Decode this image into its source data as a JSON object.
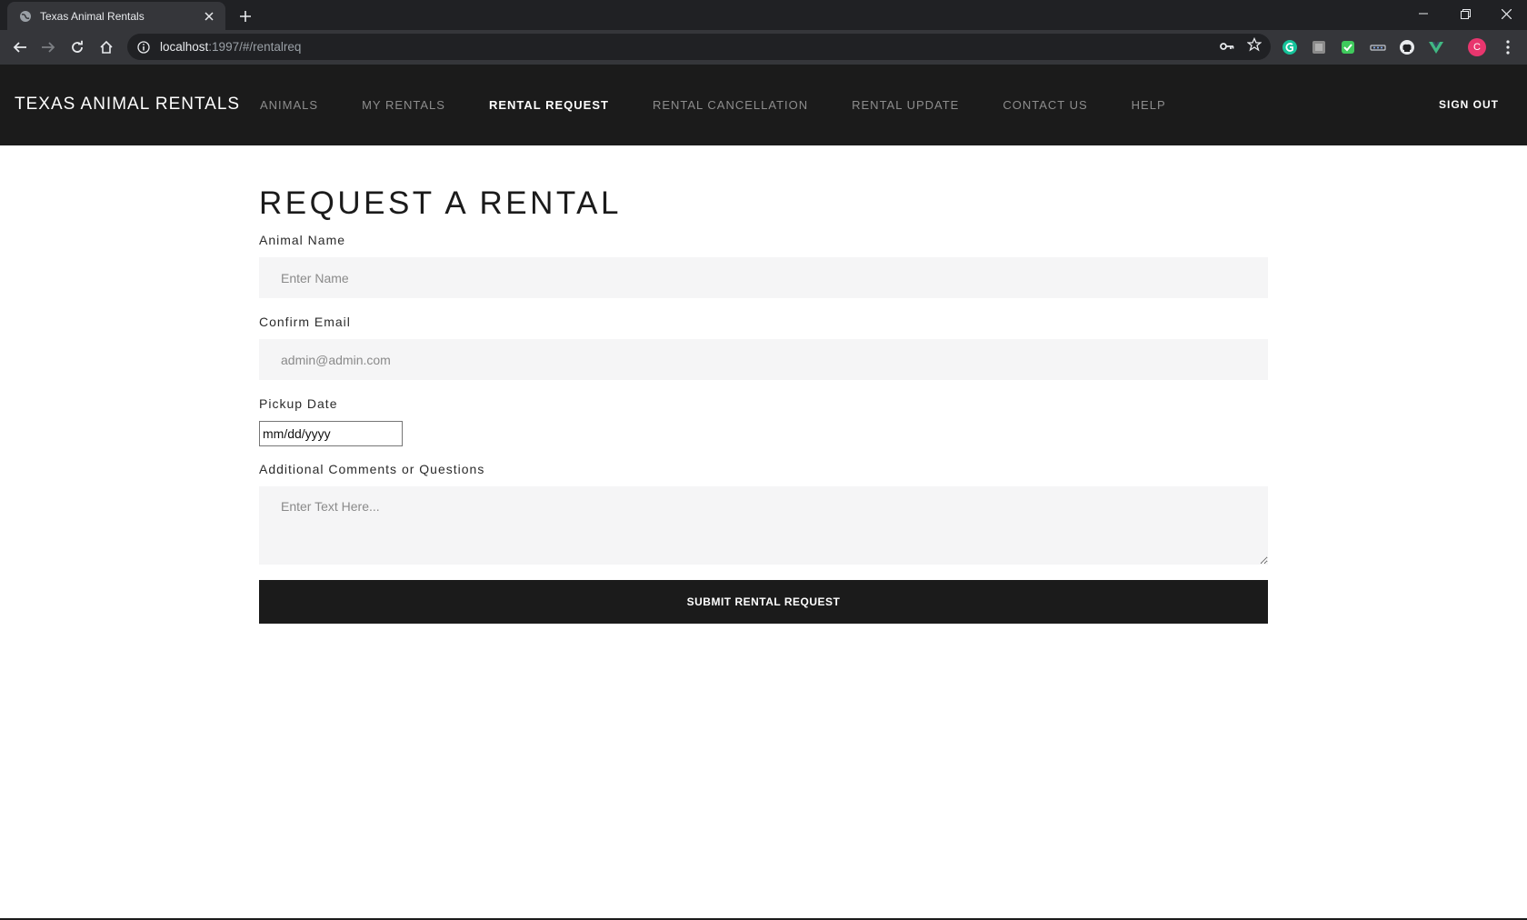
{
  "browser": {
    "tab_title": "Texas Animal Rentals",
    "url_host": "localhost",
    "url_rest": ":1997/#/rentalreq",
    "profile_initial": "C"
  },
  "site": {
    "brand": "TEXAS ANIMAL RENTALS",
    "nav": [
      {
        "label": "ANIMALS"
      },
      {
        "label": "MY RENTALS"
      },
      {
        "label": "RENTAL REQUEST"
      },
      {
        "label": "RENTAL CANCELLATION"
      },
      {
        "label": "RENTAL UPDATE"
      },
      {
        "label": "CONTACT US"
      },
      {
        "label": "HELP"
      }
    ],
    "active_nav": "RENTAL REQUEST",
    "signout": "SIGN OUT"
  },
  "form": {
    "title": "REQUEST A RENTAL",
    "animal_name_label": "Animal Name",
    "animal_name_placeholder": "Enter Name",
    "email_label": "Confirm Email",
    "email_placeholder": "admin@admin.com",
    "date_label": "Pickup Date",
    "date_value": "mm/dd/yyyy",
    "comments_label": "Additional Comments or Questions",
    "comments_placeholder": "Enter Text Here...",
    "submit_label": "SUBMIT RENTAL REQUEST"
  },
  "colors": {
    "header_bg": "#1b1b1b",
    "field_bg": "#f5f5f6",
    "button_bg": "#1b1b1b",
    "profile": "#e8366e"
  },
  "icons": [
    "globe-icon",
    "close-icon",
    "plus-icon",
    "minimize-icon",
    "restore-icon",
    "back-icon",
    "forward-icon",
    "reload-icon",
    "home-icon",
    "info-icon",
    "key-icon",
    "star-icon",
    "grammarly-icon",
    "extension-icon",
    "github-icon",
    "vue-icon",
    "menu-icon"
  ]
}
